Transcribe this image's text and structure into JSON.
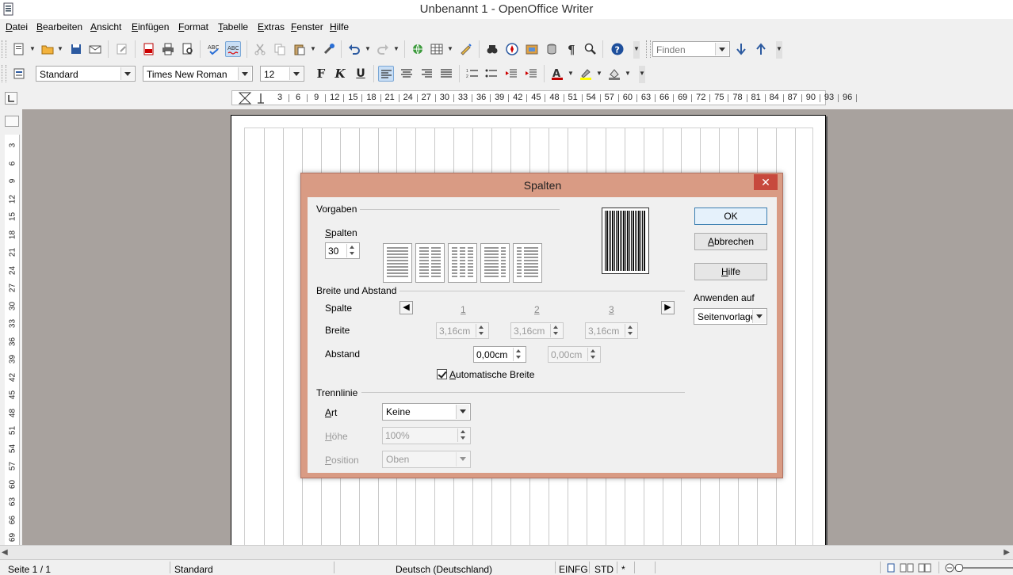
{
  "window": {
    "title": "Unbenannt 1 - OpenOffice Writer"
  },
  "menu": [
    "Datei",
    "Bearbeiten",
    "Ansicht",
    "Einfügen",
    "Format",
    "Tabelle",
    "Extras",
    "Fenster",
    "Hilfe"
  ],
  "toolbar": {
    "find_placeholder": "Finden"
  },
  "formatting": {
    "style": "Standard",
    "font": "Times New Roman",
    "size": "12",
    "bold_label": "F",
    "italic_label": "K",
    "underline_label": "U",
    "font_color": "#c00000",
    "highlight_color": "#ffff00"
  },
  "hruler_ticks": [
    "3",
    "6",
    "9",
    "12",
    "15",
    "18",
    "21",
    "24",
    "27",
    "30",
    "33",
    "36",
    "39",
    "42",
    "45",
    "48",
    "51",
    "54",
    "57",
    "60",
    "63",
    "66",
    "69",
    "72",
    "75",
    "78",
    "81",
    "84",
    "87",
    "90",
    "93",
    "96"
  ],
  "vruler_ticks": [
    "3",
    "6",
    "9",
    "12",
    "15",
    "18",
    "21",
    "24",
    "27",
    "30",
    "33",
    "36",
    "39",
    "42",
    "45",
    "48",
    "51",
    "54",
    "57",
    "60",
    "63",
    "66",
    "69"
  ],
  "dialog": {
    "title": "Spalten",
    "vorgaben": {
      "label": "Vorgaben",
      "spalten_label": "Spalten",
      "spalten_value": "30"
    },
    "breite_abstand": {
      "label": "Breite und Abstand",
      "spalte_label": "Spalte",
      "breite_label": "Breite",
      "abstand_label": "Abstand",
      "columns": [
        "1",
        "2",
        "3"
      ],
      "widths": [
        "3,16cm",
        "3,16cm",
        "3,16cm"
      ],
      "spacings": [
        "0,00cm",
        "0,00cm"
      ],
      "auto_width_label": "Automatische Breite"
    },
    "trennlinie": {
      "label": "Trennlinie",
      "art_label": "Art",
      "art_value": "Keine",
      "hoehe_label": "Höhe",
      "hoehe_value": "100%",
      "position_label": "Position",
      "position_value": "Oben"
    },
    "buttons": {
      "ok": "OK",
      "cancel": "Abbrechen",
      "help": "Hilfe"
    },
    "apply": {
      "label": "Anwenden auf",
      "value": "Seitenvorlage"
    }
  },
  "status": {
    "page": "Seite 1 / 1",
    "style": "Standard",
    "language": "Deutsch (Deutschland)",
    "insert_mode": "EINFG",
    "selection_mode": "STD",
    "modified": "*"
  }
}
